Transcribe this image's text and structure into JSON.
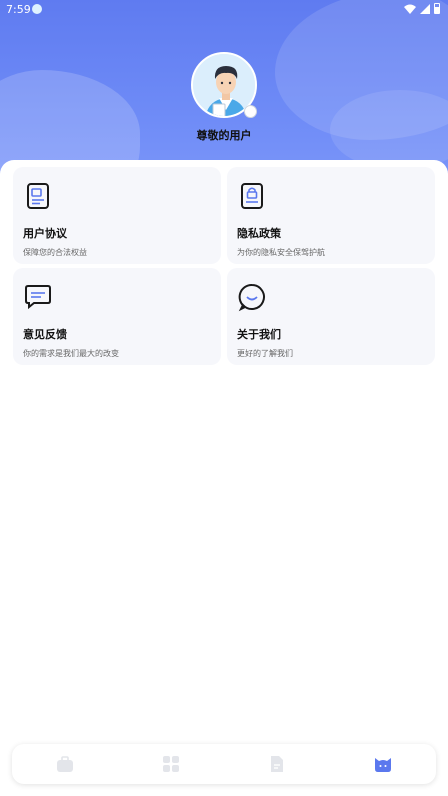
{
  "status_bar": {
    "time": "7:59"
  },
  "profile": {
    "username": "尊敬的用户"
  },
  "cards": [
    {
      "title": "用户协议",
      "desc": "保障您的合法权益",
      "icon": "document-icon"
    },
    {
      "title": "隐私政策",
      "desc": "为你的隐私安全保驾护航",
      "icon": "lock-icon"
    },
    {
      "title": "意见反馈",
      "desc": "你的需求是我们最大的改变",
      "icon": "message-icon"
    },
    {
      "title": "关于我们",
      "desc": "更好的了解我们",
      "icon": "chat-bubble-icon"
    }
  ],
  "bottom_nav": {
    "items": [
      {
        "icon": "briefcase-icon",
        "active": false
      },
      {
        "icon": "grid-icon",
        "active": false
      },
      {
        "icon": "file-icon",
        "active": false
      },
      {
        "icon": "profile-face-icon",
        "active": true
      }
    ]
  },
  "colors": {
    "hero": "#6f8cf7",
    "accent": "#5b78ee",
    "inactive_icon": "#e3e5ea"
  }
}
